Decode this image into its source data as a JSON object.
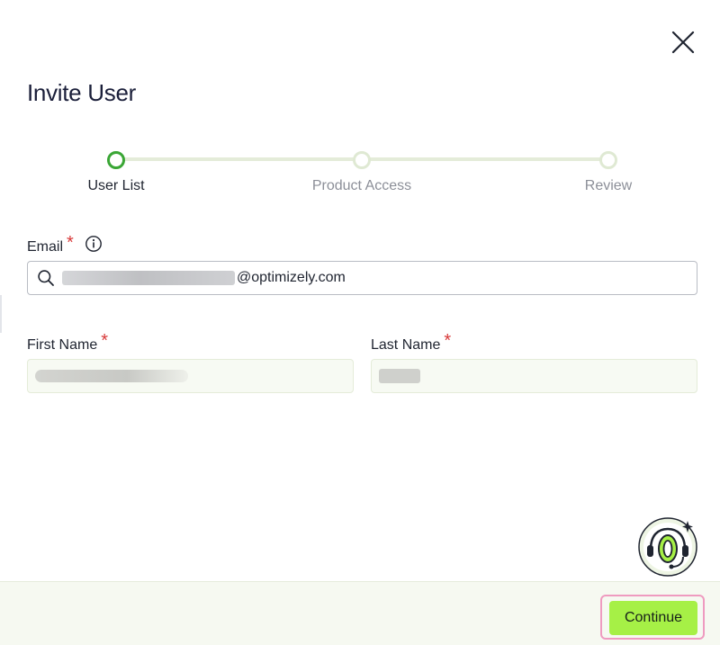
{
  "dialog": {
    "title": "Invite User",
    "close_icon": "close-icon"
  },
  "stepper": {
    "steps": [
      {
        "label": "User List",
        "active": true
      },
      {
        "label": "Product Access",
        "active": false
      },
      {
        "label": "Review",
        "active": false
      }
    ]
  },
  "form": {
    "email": {
      "label": "Email",
      "required_mark": "*",
      "value_domain": "@optimizely.com",
      "icon": "search-icon",
      "info_icon": "info-icon"
    },
    "first_name": {
      "label": "First Name",
      "required_mark": "*"
    },
    "last_name": {
      "label": "Last Name",
      "required_mark": "*"
    }
  },
  "assistant": {
    "icon": "support-assistant-icon"
  },
  "footer": {
    "continue_label": "Continue"
  },
  "colors": {
    "accent_green": "#3aa635",
    "button_green": "#a6f046",
    "required_red": "#d83a3a",
    "highlight_pink": "#ef9bc0"
  }
}
